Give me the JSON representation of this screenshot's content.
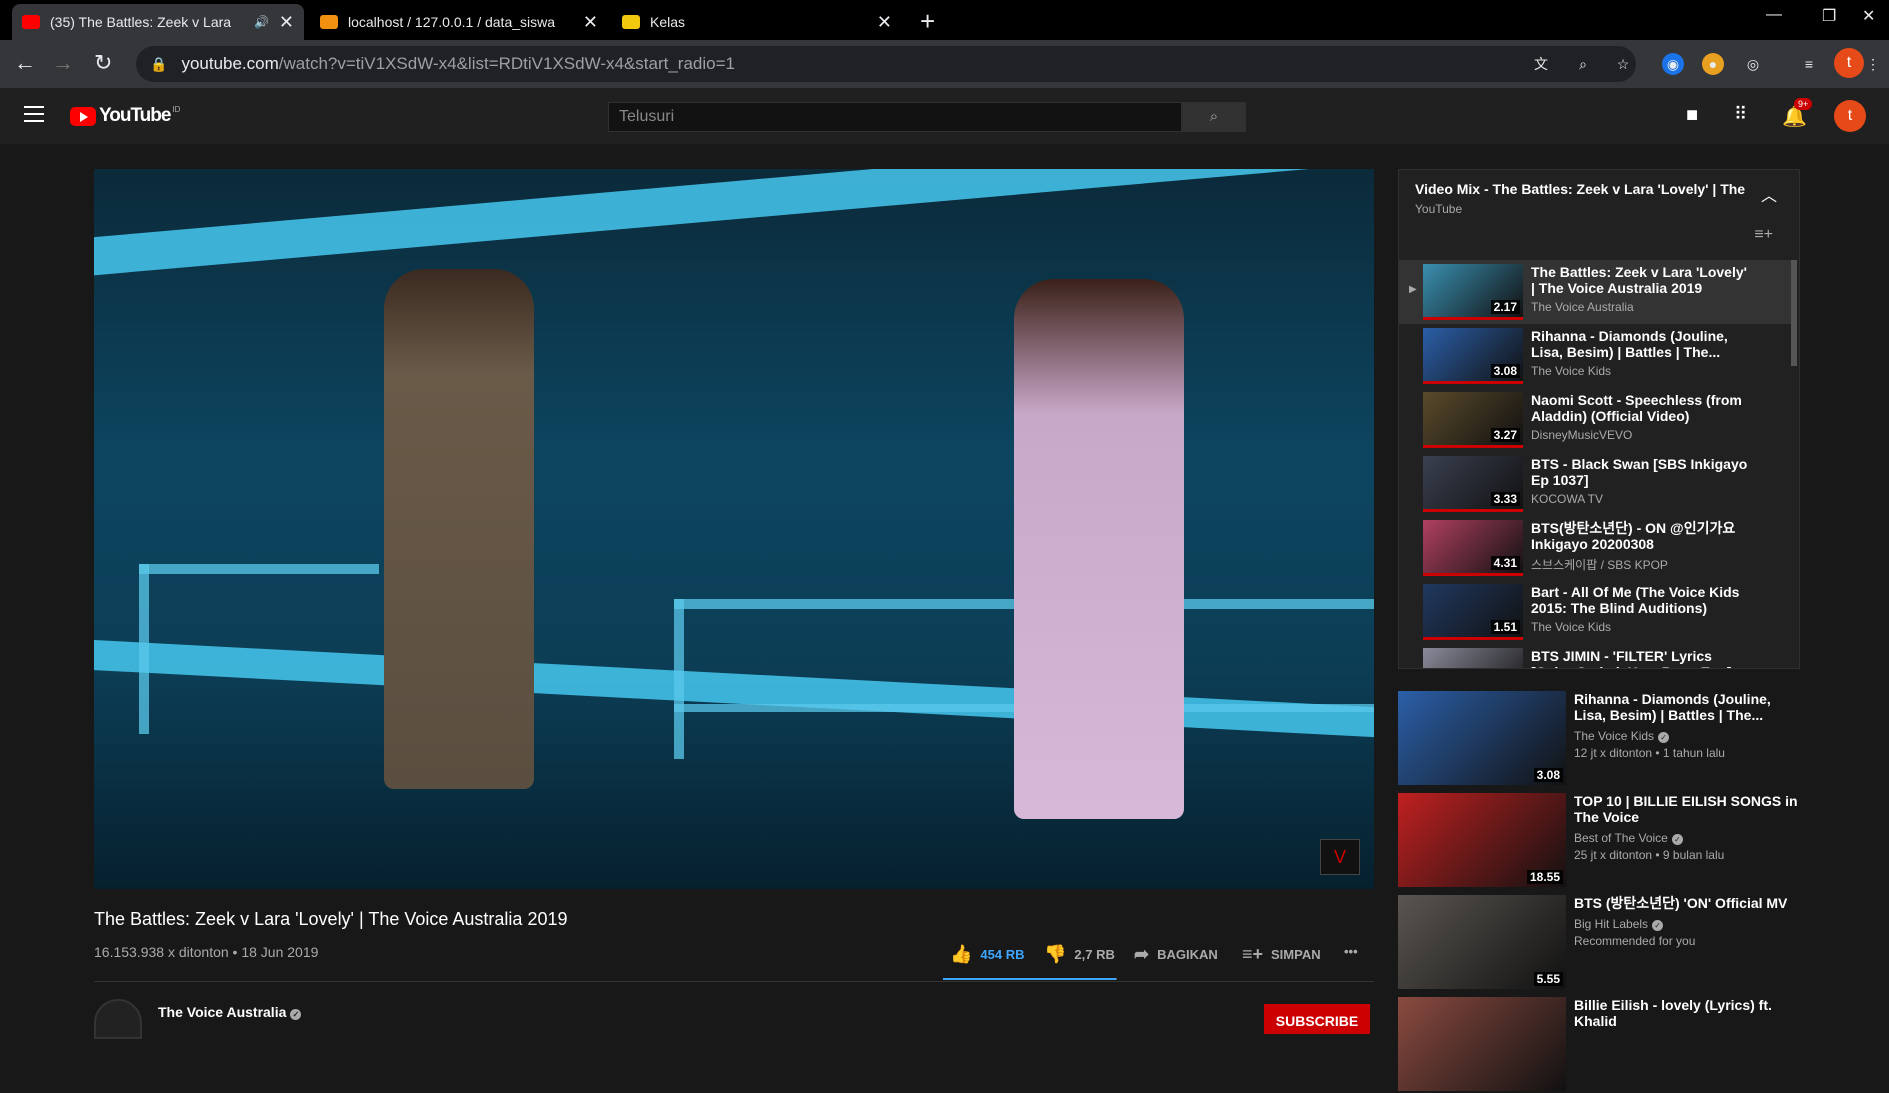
{
  "browser": {
    "tabs": [
      {
        "title": "(35) The Battles: Zeek v Lara",
        "color": "#ff0000"
      },
      {
        "title": "localhost / 127.0.0.1 / data_siswa",
        "color": "#f29111"
      },
      {
        "title": "Kelas",
        "color": "#f2c80f"
      }
    ],
    "new_tab_label": "+",
    "url_host": "youtube.com",
    "url_path": "/watch?v=tiV1XSdW-x4&list=RDtiV1XSdW-x4&start_radio=1",
    "profile_initial": "t"
  },
  "youtube": {
    "logo_text": "YouTube",
    "logo_region": "ID",
    "search_placeholder": "Telusuri",
    "notification_count": "9+",
    "avatar_initial": "t"
  },
  "video": {
    "title": "The Battles: Zeek v Lara 'Lovely' | The Voice Australia 2019",
    "meta": "16.153.938 x ditonton • 18 Jun 2019",
    "likes": "454 RB",
    "dislikes": "2,7 RB",
    "like_ratio": 0.994,
    "share_label": "BAGIKAN",
    "save_label": "SIMPAN",
    "more_label": "•••",
    "channel_name": "The Voice Australia",
    "subscribe_label": "SUBSCRIBE"
  },
  "playlist": {
    "title": "Video Mix - The Battles: Zeek v Lara 'Lovely' | The V...",
    "owner": "YouTube",
    "items": [
      {
        "title": "The Battles: Zeek v Lara 'Lovely' | The Voice Australia 2019",
        "channel": "The Voice Australia",
        "duration": "2.17",
        "color": "#3a8fb0"
      },
      {
        "title": "Rihanna - Diamonds (Jouline, Lisa, Besim) | Battles | The...",
        "channel": "The Voice Kids",
        "duration": "3.08",
        "color": "#2b5fa8"
      },
      {
        "title": "Naomi Scott - Speechless (from Aladdin) (Official Video)",
        "channel": "DisneyMusicVEVO",
        "duration": "3.27",
        "color": "#5a4a2a"
      },
      {
        "title": "BTS - Black Swan [SBS Inkigayo Ep 1037]",
        "channel": "KOCOWA TV",
        "duration": "3.33",
        "color": "#3a4050"
      },
      {
        "title": "BTS(방탄소년단) - ON @인기가요 Inkigayo 20200308",
        "channel": "스브스케이팝 / SBS KPOP",
        "duration": "4.31",
        "color": "#b04060"
      },
      {
        "title": "Bart - All Of Me (The Voice Kids 2015: The Blind Auditions)",
        "channel": "The Voice Kids",
        "duration": "1.51",
        "color": "#203860"
      },
      {
        "title": "BTS JIMIN - 'FILTER' Lyrics [Color Coded_Han_Rom_Eng]",
        "channel": "",
        "duration": "",
        "color": "#8a8a9a"
      }
    ]
  },
  "recommendations": [
    {
      "title": "Rihanna - Diamonds (Jouline, Lisa, Besim) | Battles | The...",
      "channel": "The Voice Kids",
      "views": "12 jt x ditonton • 1 tahun lalu",
      "duration": "3.08",
      "color": "#2b5fa8"
    },
    {
      "title": "TOP 10 | BILLIE EILISH SONGS in The Voice",
      "channel": "Best of The Voice",
      "views": "25 jt x ditonton • 9 bulan lalu",
      "duration": "18.55",
      "color": "#c02020"
    },
    {
      "title": "BTS (방탄소년단) 'ON' Official MV",
      "channel": "Big Hit Labels",
      "views": "Recommended for you",
      "duration": "5.55",
      "color": "#5a5550"
    },
    {
      "title": "Billie Eilish - lovely (Lyrics) ft. Khalid",
      "channel": "",
      "views": "",
      "duration": "",
      "color": "#8a4a40"
    }
  ]
}
